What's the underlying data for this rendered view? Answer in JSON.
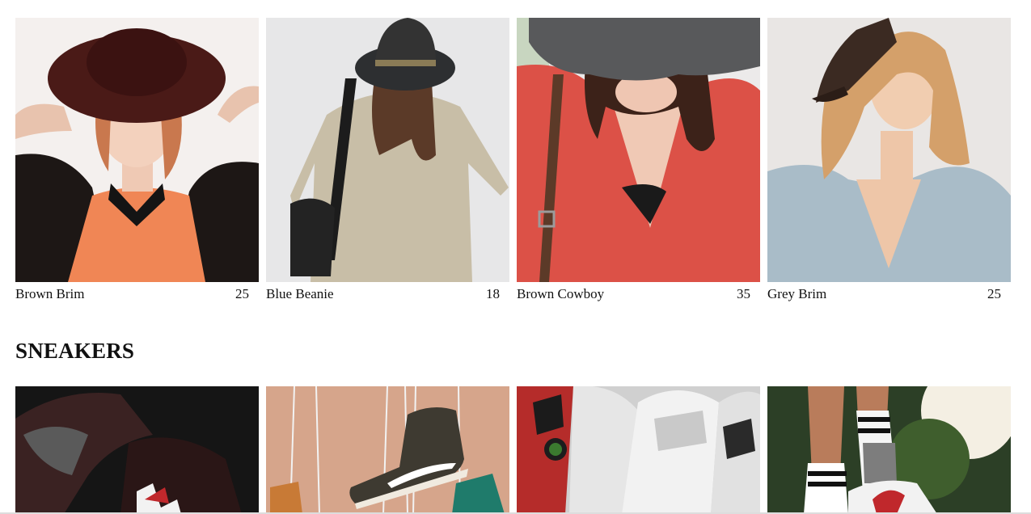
{
  "hats": [
    {
      "name": "Brown Brim",
      "price": "25"
    },
    {
      "name": "Blue Beanie",
      "price": "18"
    },
    {
      "name": "Brown Cowboy",
      "price": "35"
    },
    {
      "name": "Grey Brim",
      "price": "25"
    }
  ],
  "sneakers": {
    "title": "SNEAKERS"
  },
  "colors": {
    "text": "#111111",
    "background": "#ffffff"
  }
}
